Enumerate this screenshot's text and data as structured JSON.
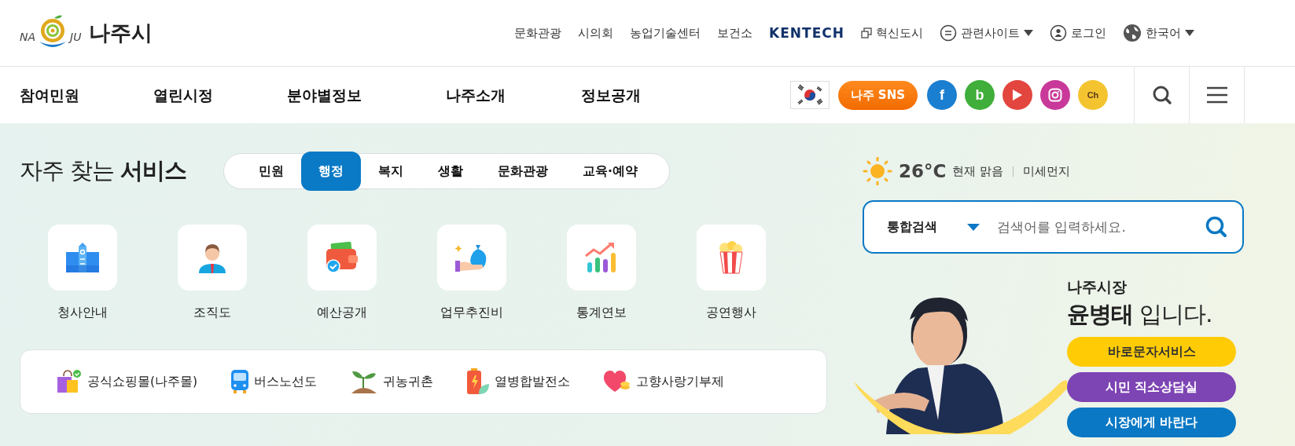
{
  "logo": {
    "left": "NA",
    "right": "JU",
    "name": "나주시"
  },
  "top_links": [
    {
      "label": "문화관광",
      "kind": "plain"
    },
    {
      "label": "시의회",
      "kind": "plain"
    },
    {
      "label": "농업기술센터",
      "kind": "plain"
    },
    {
      "label": "보건소",
      "kind": "plain"
    },
    {
      "label": "KENTECH",
      "kind": "brand"
    },
    {
      "label": "혁신도시",
      "kind": "window"
    },
    {
      "label": "관련사이트",
      "kind": "menu",
      "dropdown": true
    },
    {
      "label": "로그인",
      "kind": "user"
    },
    {
      "label": "한국어",
      "kind": "globe",
      "dropdown": true
    }
  ],
  "nav": [
    "참여민원",
    "열린시정",
    "분야별정보",
    "나주소개",
    "정보공개"
  ],
  "sns_button": "나주 SNS",
  "social": [
    {
      "kind": "text",
      "label": "f",
      "color": "#1a7fd0"
    },
    {
      "kind": "text",
      "label": "b",
      "color": "#3fae3a"
    },
    {
      "kind": "play",
      "color": "#e2463f"
    },
    {
      "kind": "camera",
      "color": "#c8399a"
    },
    {
      "kind": "text",
      "label": "Ch",
      "color": "#f4c430"
    }
  ],
  "services": {
    "title": "자주 찾는 **서비스**",
    "tabs": [
      {
        "label": "민원",
        "selected": false
      },
      {
        "label": "행정",
        "selected": true
      },
      {
        "label": "복지",
        "selected": false
      },
      {
        "label": "생활",
        "selected": false
      },
      {
        "label": "문화관광",
        "selected": false
      },
      {
        "label": "교육·예약",
        "selected": false
      }
    ],
    "items": [
      "청사안내",
      "조직도",
      "예산공개",
      "업무추진비",
      "통계연보",
      "공연행사"
    ]
  },
  "quick_links": [
    "공식쇼핑몰(나주몰)",
    "버스노선도",
    "귀농귀촌",
    "열병합발전소",
    "고향사랑기부제"
  ],
  "weather": {
    "temperature": "26°C",
    "condition": "현재 맑음",
    "dust": "미세먼지"
  },
  "search": {
    "scope": "통합검색",
    "placeholder": "검색어를 입력하세요."
  },
  "mayor": {
    "title": "나주시장",
    "greeting": "**윤병태** 입니다.",
    "buttons": [
      {
        "label": "바로문자서비스",
        "color": "#ffcb05"
      },
      {
        "label": "시민 직소상담실",
        "color": "#7d44b3"
      },
      {
        "label": "시장에게 바란다",
        "color": "#0a78c4"
      }
    ]
  }
}
